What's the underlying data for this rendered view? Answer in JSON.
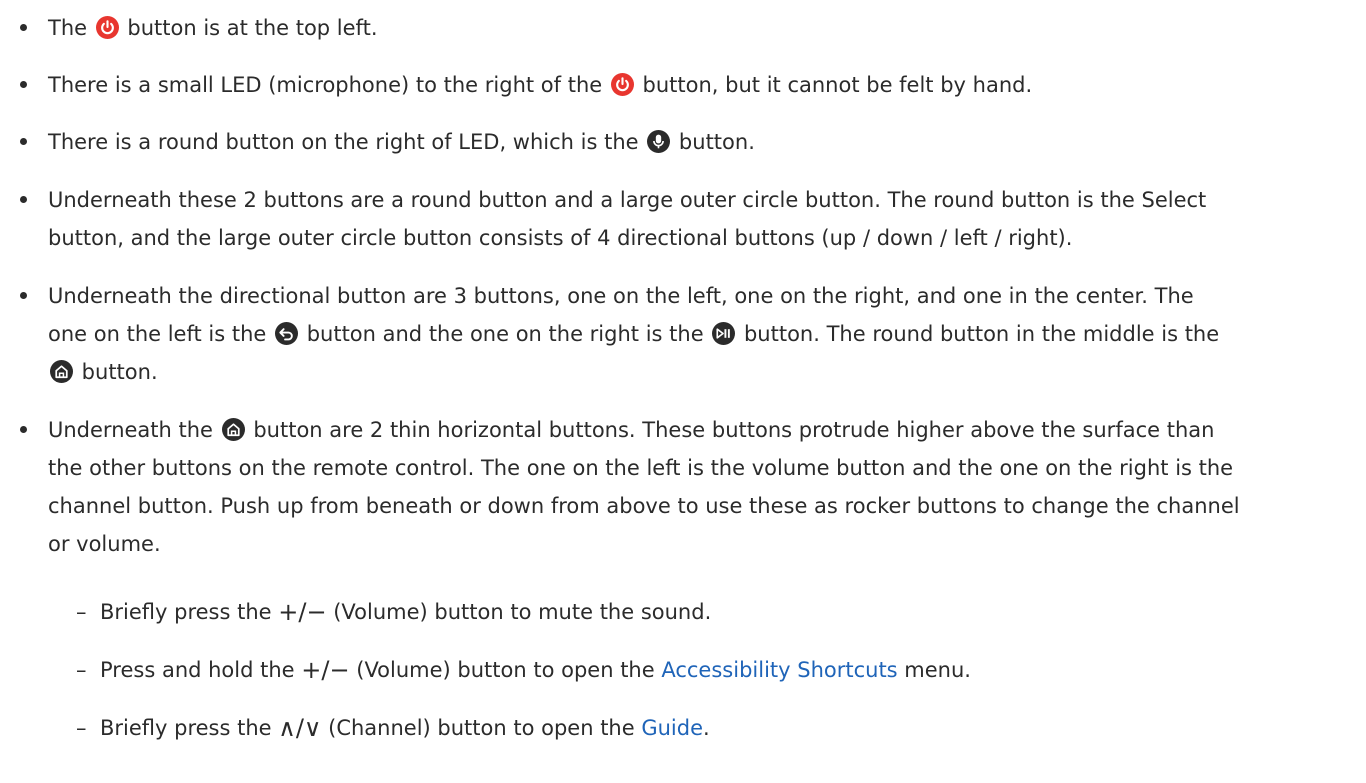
{
  "items": [
    {
      "lines": [
        {
          "parts": [
            "The ",
            {
              "icon": "power-icon"
            },
            " button is at the top left."
          ]
        }
      ]
    },
    {
      "lines": [
        {
          "parts": [
            "There is a small LED (microphone) to the right of the ",
            {
              "icon": "power-icon"
            },
            " button, but it cannot be felt by hand."
          ]
        }
      ]
    },
    {
      "lines": [
        {
          "parts": [
            "There is a round button on the right of LED, which is the ",
            {
              "icon": "microphone-icon"
            },
            " button."
          ]
        }
      ]
    },
    {
      "lines": [
        {
          "parts": [
            "Underneath these 2 buttons are a round button and a large outer circle button. The round button is the Select"
          ]
        },
        {
          "parts": [
            "button, and the large outer circle button consists of 4 directional buttons (up / down / left / right)."
          ]
        }
      ]
    },
    {
      "lines": [
        {
          "parts": [
            "Underneath the directional button are 3 buttons, one on the left, one on the right, and one in the center. The"
          ]
        },
        {
          "parts": [
            "one on the left is the ",
            {
              "icon": "return-icon"
            },
            " button and the one on the right is the ",
            {
              "icon": "play-pause-icon"
            },
            " button. The round button in the middle is the"
          ]
        },
        {
          "parts": [
            {
              "icon": "home-icon"
            },
            " button."
          ]
        }
      ]
    },
    {
      "lines": [
        {
          "parts": [
            "Underneath the ",
            {
              "icon": "home-icon"
            },
            " button are 2 thin horizontal buttons. These buttons protrude higher above the surface than"
          ]
        },
        {
          "parts": [
            "the other buttons on the remote control. The one on the left is the volume button and the one on the right is the"
          ]
        },
        {
          "parts": [
            "channel button. Push up from beneath or down from above to use these as rocker buttons to change the channel"
          ]
        },
        {
          "parts": [
            "or volume."
          ]
        }
      ]
    }
  ],
  "subitems": [
    {
      "parts": [
        "Briefly press the ",
        {
          "sym": "+/−"
        },
        " (Volume) button to mute the sound."
      ]
    },
    {
      "parts": [
        "Press and hold the ",
        {
          "sym": "+/−"
        },
        " (Volume) button to open the ",
        {
          "link": "Accessibility Shortcuts"
        },
        " menu."
      ]
    },
    {
      "parts": [
        "Briefly press the ",
        {
          "sym": "∧/∨"
        },
        " (Channel) button to open the ",
        {
          "link": "Guide"
        },
        "."
      ]
    }
  ],
  "dash": "–",
  "colors": {
    "text": "#2b2b2b",
    "link": "#1f64b8",
    "power": "#e8362f",
    "icon_dark": "#2b2b2b"
  }
}
